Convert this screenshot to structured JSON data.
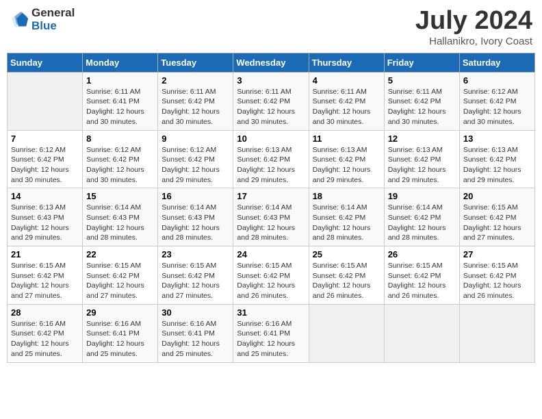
{
  "header": {
    "logo_general": "General",
    "logo_blue": "Blue",
    "month_title": "July 2024",
    "location": "Hallanikro, Ivory Coast"
  },
  "days_of_week": [
    "Sunday",
    "Monday",
    "Tuesday",
    "Wednesday",
    "Thursday",
    "Friday",
    "Saturday"
  ],
  "weeks": [
    [
      {
        "num": "",
        "info": ""
      },
      {
        "num": "1",
        "info": "Sunrise: 6:11 AM\nSunset: 6:41 PM\nDaylight: 12 hours\nand 30 minutes."
      },
      {
        "num": "2",
        "info": "Sunrise: 6:11 AM\nSunset: 6:42 PM\nDaylight: 12 hours\nand 30 minutes."
      },
      {
        "num": "3",
        "info": "Sunrise: 6:11 AM\nSunset: 6:42 PM\nDaylight: 12 hours\nand 30 minutes."
      },
      {
        "num": "4",
        "info": "Sunrise: 6:11 AM\nSunset: 6:42 PM\nDaylight: 12 hours\nand 30 minutes."
      },
      {
        "num": "5",
        "info": "Sunrise: 6:11 AM\nSunset: 6:42 PM\nDaylight: 12 hours\nand 30 minutes."
      },
      {
        "num": "6",
        "info": "Sunrise: 6:12 AM\nSunset: 6:42 PM\nDaylight: 12 hours\nand 30 minutes."
      }
    ],
    [
      {
        "num": "7",
        "info": "Sunrise: 6:12 AM\nSunset: 6:42 PM\nDaylight: 12 hours\nand 30 minutes."
      },
      {
        "num": "8",
        "info": "Sunrise: 6:12 AM\nSunset: 6:42 PM\nDaylight: 12 hours\nand 30 minutes."
      },
      {
        "num": "9",
        "info": "Sunrise: 6:12 AM\nSunset: 6:42 PM\nDaylight: 12 hours\nand 29 minutes."
      },
      {
        "num": "10",
        "info": "Sunrise: 6:13 AM\nSunset: 6:42 PM\nDaylight: 12 hours\nand 29 minutes."
      },
      {
        "num": "11",
        "info": "Sunrise: 6:13 AM\nSunset: 6:42 PM\nDaylight: 12 hours\nand 29 minutes."
      },
      {
        "num": "12",
        "info": "Sunrise: 6:13 AM\nSunset: 6:42 PM\nDaylight: 12 hours\nand 29 minutes."
      },
      {
        "num": "13",
        "info": "Sunrise: 6:13 AM\nSunset: 6:42 PM\nDaylight: 12 hours\nand 29 minutes."
      }
    ],
    [
      {
        "num": "14",
        "info": "Sunrise: 6:13 AM\nSunset: 6:43 PM\nDaylight: 12 hours\nand 29 minutes."
      },
      {
        "num": "15",
        "info": "Sunrise: 6:14 AM\nSunset: 6:43 PM\nDaylight: 12 hours\nand 28 minutes."
      },
      {
        "num": "16",
        "info": "Sunrise: 6:14 AM\nSunset: 6:43 PM\nDaylight: 12 hours\nand 28 minutes."
      },
      {
        "num": "17",
        "info": "Sunrise: 6:14 AM\nSunset: 6:43 PM\nDaylight: 12 hours\nand 28 minutes."
      },
      {
        "num": "18",
        "info": "Sunrise: 6:14 AM\nSunset: 6:42 PM\nDaylight: 12 hours\nand 28 minutes."
      },
      {
        "num": "19",
        "info": "Sunrise: 6:14 AM\nSunset: 6:42 PM\nDaylight: 12 hours\nand 28 minutes."
      },
      {
        "num": "20",
        "info": "Sunrise: 6:15 AM\nSunset: 6:42 PM\nDaylight: 12 hours\nand 27 minutes."
      }
    ],
    [
      {
        "num": "21",
        "info": "Sunrise: 6:15 AM\nSunset: 6:42 PM\nDaylight: 12 hours\nand 27 minutes."
      },
      {
        "num": "22",
        "info": "Sunrise: 6:15 AM\nSunset: 6:42 PM\nDaylight: 12 hours\nand 27 minutes."
      },
      {
        "num": "23",
        "info": "Sunrise: 6:15 AM\nSunset: 6:42 PM\nDaylight: 12 hours\nand 27 minutes."
      },
      {
        "num": "24",
        "info": "Sunrise: 6:15 AM\nSunset: 6:42 PM\nDaylight: 12 hours\nand 26 minutes."
      },
      {
        "num": "25",
        "info": "Sunrise: 6:15 AM\nSunset: 6:42 PM\nDaylight: 12 hours\nand 26 minutes."
      },
      {
        "num": "26",
        "info": "Sunrise: 6:15 AM\nSunset: 6:42 PM\nDaylight: 12 hours\nand 26 minutes."
      },
      {
        "num": "27",
        "info": "Sunrise: 6:15 AM\nSunset: 6:42 PM\nDaylight: 12 hours\nand 26 minutes."
      }
    ],
    [
      {
        "num": "28",
        "info": "Sunrise: 6:16 AM\nSunset: 6:42 PM\nDaylight: 12 hours\nand 25 minutes."
      },
      {
        "num": "29",
        "info": "Sunrise: 6:16 AM\nSunset: 6:41 PM\nDaylight: 12 hours\nand 25 minutes."
      },
      {
        "num": "30",
        "info": "Sunrise: 6:16 AM\nSunset: 6:41 PM\nDaylight: 12 hours\nand 25 minutes."
      },
      {
        "num": "31",
        "info": "Sunrise: 6:16 AM\nSunset: 6:41 PM\nDaylight: 12 hours\nand 25 minutes."
      },
      {
        "num": "",
        "info": ""
      },
      {
        "num": "",
        "info": ""
      },
      {
        "num": "",
        "info": ""
      }
    ]
  ]
}
